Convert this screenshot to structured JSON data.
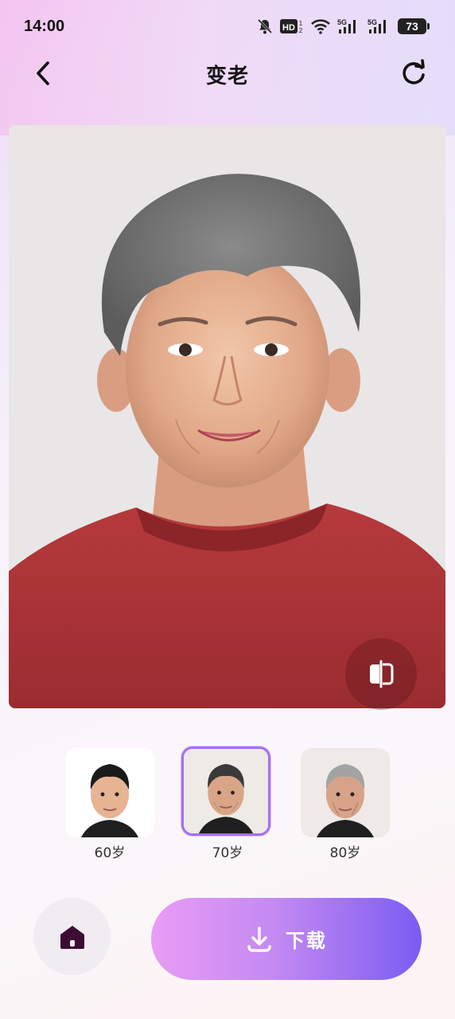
{
  "status_bar": {
    "time": "14:00",
    "battery": "73",
    "icons": [
      "mute-bell-icon",
      "hd-icon",
      "wifi-icon",
      "signal-5g-icon",
      "signal-5g-icon",
      "battery-icon"
    ]
  },
  "header": {
    "title": "变老",
    "back_icon": "chevron-left-icon",
    "refresh_icon": "refresh-icon"
  },
  "preview": {
    "compare_icon": "compare-icon"
  },
  "age_options": [
    {
      "label": "60岁",
      "selected": false
    },
    {
      "label": "70岁",
      "selected": true
    },
    {
      "label": "80岁",
      "selected": false
    }
  ],
  "footer": {
    "home_icon": "home-icon",
    "download_label": "下载",
    "download_icon": "download-icon"
  },
  "colors": {
    "accent": "#a46ff0",
    "gradient_start": "#e99cf4",
    "gradient_end": "#7a5cf2"
  }
}
